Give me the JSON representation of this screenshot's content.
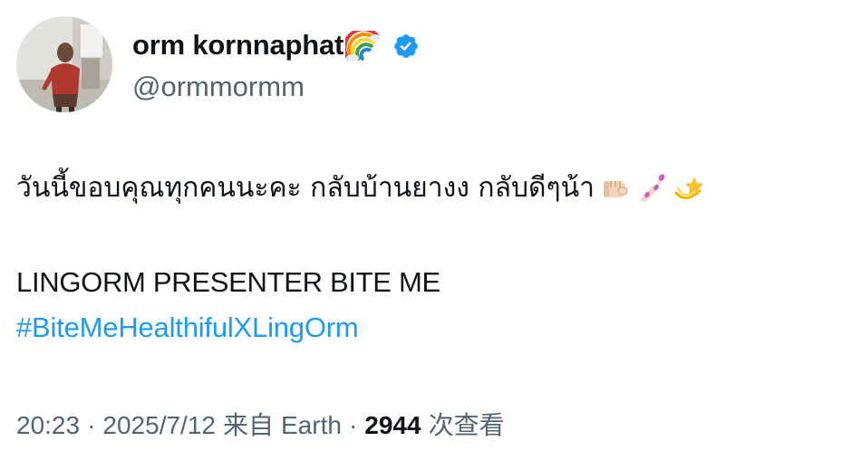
{
  "author": {
    "display_name": "orm kornnaphat",
    "handle": "@ormmormm",
    "rainbow_emoji": "rainbow-icon",
    "verified_color": "#1d9bf0"
  },
  "tweet": {
    "thai_text": "วันนี้ขอบคุณทุกคนนะคะ กลับบ้านยางง กลับดีๆน้า",
    "emojis": [
      "oncoming-fist-icon",
      "nail-polish-icon",
      "dizzy-icon"
    ],
    "caption": "LINGORM PRESENTER BITE ME",
    "hashtag": "#BiteMeHealthifulXLingOrm"
  },
  "meta": {
    "time": "20:23",
    "dot1": "·",
    "date": "2025/7/12",
    "source_prefix": "来自",
    "source": "Earth",
    "dot2": "·",
    "views_count": "2944",
    "views_label": "次查看"
  },
  "colors": {
    "text": "#0f1419",
    "muted": "#536471",
    "link": "#1d9bf0"
  }
}
